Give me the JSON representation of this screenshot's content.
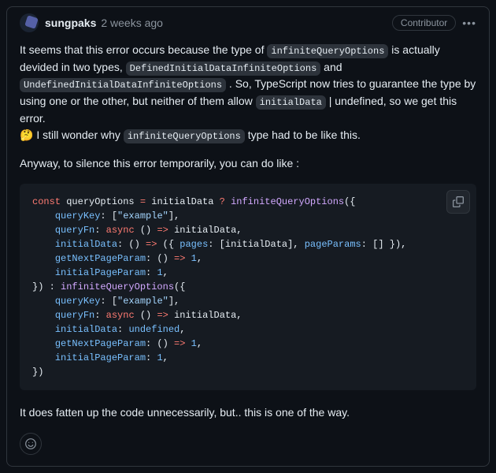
{
  "header": {
    "author": "sungpaks",
    "timestamp": "2 weeks ago",
    "badge": "Contributor"
  },
  "body": {
    "p1_a": "It seems that this error occurs because the type of ",
    "p1_code1": "infiniteQueryOptions",
    "p1_b": " is actually devided in two types, ",
    "p1_code2": "DefinedInitialDataInfiniteOptions",
    "p1_c": " and ",
    "p1_code3": "UndefinedInitialDataInfiniteOptions",
    "p1_d": " . So, TypeScript now tries to guarantee the type by using one or the other, but neither of them allow ",
    "p1_code4": "initialData",
    "p1_e": " | undefined, so we get this error.",
    "p2_emoji": "🤔",
    "p2_a": " I still wonder why ",
    "p2_code1": "infiniteQueryOptions",
    "p2_b": " type had to be like this.",
    "p3": "Anyway, to silence this error temporarily, you can do like :",
    "p4": "It does fatten up the code unnecessarily, but.. this is one of the way."
  },
  "code": {
    "l1": {
      "kw": "const",
      "sp": " ",
      "var": "queryOptions",
      "eq": " = ",
      "id": "initialData",
      "q": " ? ",
      "fn": "infiniteQueryOptions",
      "op": "({"
    },
    "l2": {
      "indent": "    ",
      "key": "queryKey",
      "col": ": [",
      "str": "\"example\"",
      "end": "],"
    },
    "l3": {
      "indent": "    ",
      "key": "queryFn",
      "col": ": ",
      "async": "async",
      "paren": " () ",
      "arrow": "=>",
      "sp": " ",
      "id": "initialData",
      "end": ","
    },
    "l4": {
      "indent": "    ",
      "key": "initialData",
      "col": ": () ",
      "arrow": "=>",
      "op": " ({ ",
      "k1": "pages",
      "c1": ": [",
      "id": "initialData",
      "c2": "], ",
      "k2": "pageParams",
      "c3": ": [] }),"
    },
    "l5": {
      "indent": "    ",
      "key": "getNextPageParam",
      "col": ": () ",
      "arrow": "=>",
      "sp": " ",
      "num": "1",
      "end": ","
    },
    "l6": {
      "indent": "    ",
      "key": "initialPageParam",
      "col": ": ",
      "num": "1",
      "end": ","
    },
    "l7": {
      "close": "}) : ",
      "fn": "infiniteQueryOptions",
      "op": "({"
    },
    "l8": {
      "indent": "    ",
      "key": "queryKey",
      "col": ": [",
      "str": "\"example\"",
      "end": "],"
    },
    "l9": {
      "indent": "    ",
      "key": "queryFn",
      "col": ": ",
      "async": "async",
      "paren": " () ",
      "arrow": "=>",
      "sp": " ",
      "id": "initialData",
      "end": ","
    },
    "l10": {
      "indent": "    ",
      "key": "initialData",
      "col": ": ",
      "undef": "undefined",
      "end": ","
    },
    "l11": {
      "indent": "    ",
      "key": "getNextPageParam",
      "col": ": () ",
      "arrow": "=>",
      "sp": " ",
      "num": "1",
      "end": ","
    },
    "l12": {
      "indent": "    ",
      "key": "initialPageParam",
      "col": ": ",
      "num": "1",
      "end": ","
    },
    "l13": {
      "close": "})"
    }
  }
}
